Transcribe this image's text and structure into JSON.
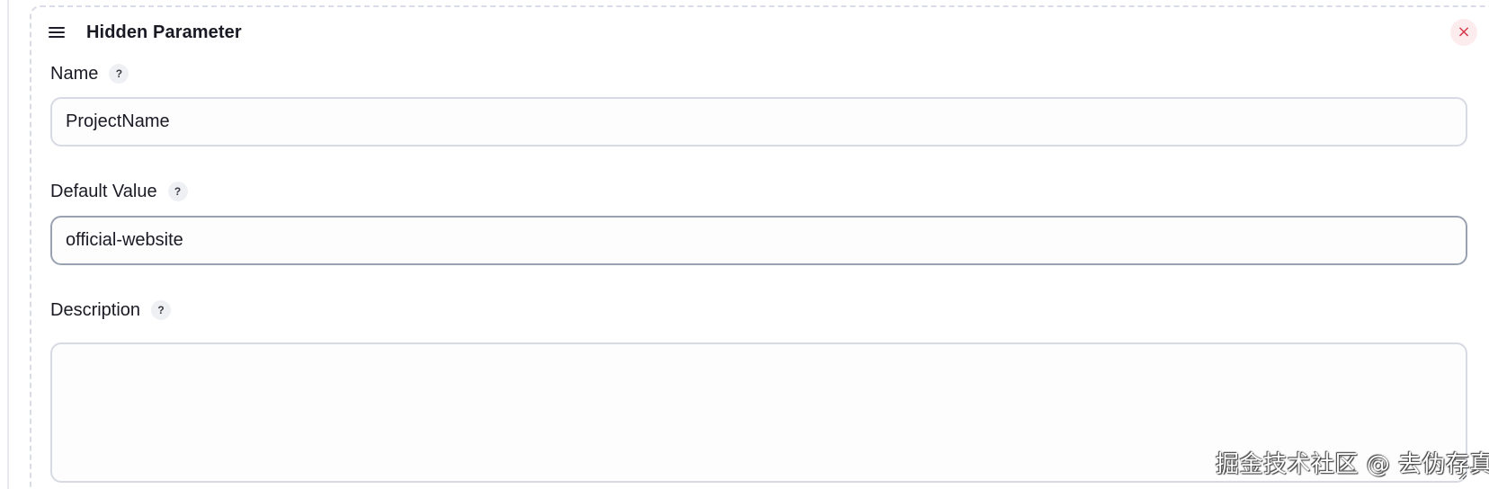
{
  "card": {
    "title": "Hidden Parameter",
    "close_label": "×"
  },
  "fields": {
    "name": {
      "label": "Name",
      "help": "?",
      "value": "ProjectName"
    },
    "default_value": {
      "label": "Default Value",
      "help": "?",
      "value": "official-website"
    },
    "description": {
      "label": "Description",
      "help": "?",
      "value": ""
    }
  },
  "watermark": {
    "text": "掘金技术社区 @ 去伪存真"
  },
  "colors": {
    "close_bg": "#fdecee",
    "close_fg": "#d53b4d",
    "input_border": "#d7dae2",
    "input_border_focused": "#9aa1b0",
    "card_border": "#d9dce6"
  }
}
